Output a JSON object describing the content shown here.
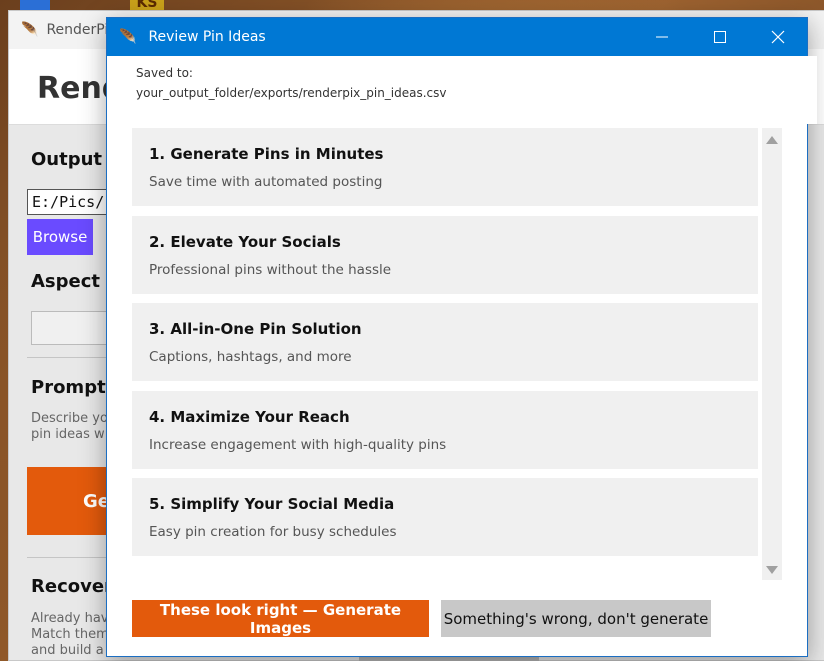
{
  "background_window": {
    "title": "RenderPix",
    "app_title": "Rend",
    "output_label": "Output F",
    "output_value": "E:/Pics/ren",
    "browse_label": "Browse",
    "aspect_label": "Aspect R",
    "prompt_label": "Prompt A",
    "prompt_desc_1": "Describe yo",
    "prompt_desc_2": "pin ideas w",
    "generate_label": "Ge",
    "recovery_label": "Recovery",
    "recovery_desc_1": "Already hav",
    "recovery_desc_2": "Match them",
    "recovery_desc_3": "and build a"
  },
  "desktop": {
    "badge": "KS"
  },
  "dialog": {
    "title": "Review Pin Ideas",
    "saved_label": "Saved to:",
    "saved_path": "your_output_folder/exports/renderpix_pin_ideas.csv",
    "ideas": [
      {
        "title": "1. Generate Pins in Minutes",
        "subtitle": "Save time with automated posting"
      },
      {
        "title": "2. Elevate Your Socials",
        "subtitle": "Professional pins without the hassle"
      },
      {
        "title": "3. All-in-One Pin Solution",
        "subtitle": "Captions, hashtags, and more"
      },
      {
        "title": "4. Maximize Your Reach",
        "subtitle": "Increase engagement with high-quality pins"
      },
      {
        "title": "5. Simplify Your Social Media",
        "subtitle": "Easy pin creation for busy schedules"
      }
    ],
    "confirm_label": "These look right — Generate Images",
    "reject_label": "Something's wrong, don't generate"
  },
  "colors": {
    "titlebar": "#0078d4",
    "accent_orange": "#e35a0c",
    "browse_purple": "#6a4bff",
    "card_bg": "#f0f0f0"
  },
  "icons": [
    "feather-icon",
    "minimize-icon",
    "maximize-icon",
    "close-icon",
    "scroll-up-icon",
    "scroll-down-icon"
  ]
}
